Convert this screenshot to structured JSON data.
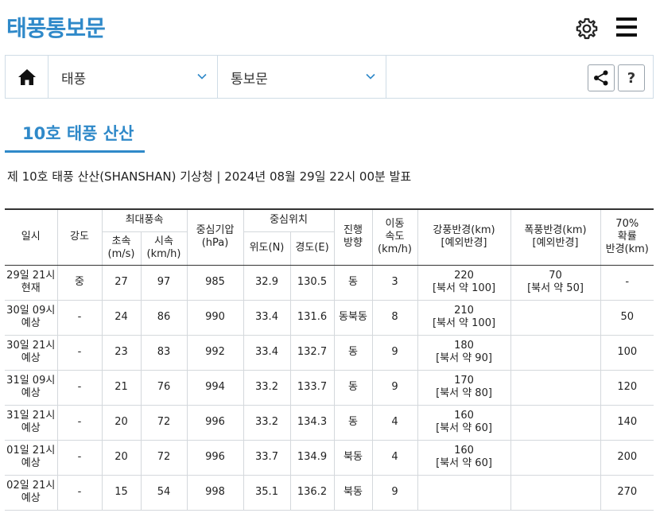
{
  "header": {
    "title": "태풍통보문"
  },
  "nav": {
    "select1": "태풍",
    "select2": "통보문",
    "help": "?"
  },
  "tab": {
    "label": "10호 태풍 산산"
  },
  "subtitle": "제 10호 태풍 산산(SHANSHAN) 기상청 | 2024년 08월 29일 22시 00분 발표",
  "table": {
    "headers": {
      "date": "일시",
      "intensity": "강도",
      "max_wind": "최대풍속",
      "wind_ms": [
        "초속",
        "(m/s)"
      ],
      "wind_kmh": [
        "시속",
        "(km/h)"
      ],
      "pressure": [
        "중심기압",
        "(hPa)"
      ],
      "position": "중심위치",
      "lat": "위도(N)",
      "lon": "경도(E)",
      "direction": [
        "진행",
        "방향"
      ],
      "speed": [
        "이동",
        "속도",
        "(km/h)"
      ],
      "strong_radius": [
        "강풍반경(km)",
        "[예외반경]"
      ],
      "storm_radius": [
        "폭풍반경(km)",
        "[예외반경]"
      ],
      "prob_radius": [
        "70%",
        "확률",
        "반경(km)"
      ]
    },
    "rows": [
      {
        "date": [
          "29일 21시",
          "현재"
        ],
        "intensity": "중",
        "wind_ms": "27",
        "wind_kmh": "97",
        "pressure": "985",
        "lat": "32.9",
        "lon": "130.5",
        "direction": "동",
        "speed": "3",
        "strong": [
          "220",
          "[북서 약 100]"
        ],
        "storm": [
          "70",
          "[북서 약 50]"
        ],
        "prob": "-"
      },
      {
        "date": [
          "30일 09시",
          "예상"
        ],
        "intensity": "-",
        "wind_ms": "24",
        "wind_kmh": "86",
        "pressure": "990",
        "lat": "33.4",
        "lon": "131.6",
        "direction": "동북동",
        "speed": "8",
        "strong": [
          "210",
          "[북서 약 100]"
        ],
        "storm": [
          "",
          ""
        ],
        "prob": "50"
      },
      {
        "date": [
          "30일 21시",
          "예상"
        ],
        "intensity": "-",
        "wind_ms": "23",
        "wind_kmh": "83",
        "pressure": "992",
        "lat": "33.4",
        "lon": "132.7",
        "direction": "동",
        "speed": "9",
        "strong": [
          "180",
          "[북서 약 90]"
        ],
        "storm": [
          "",
          ""
        ],
        "prob": "100"
      },
      {
        "date": [
          "31일 09시",
          "예상"
        ],
        "intensity": "-",
        "wind_ms": "21",
        "wind_kmh": "76",
        "pressure": "994",
        "lat": "33.2",
        "lon": "133.7",
        "direction": "동",
        "speed": "9",
        "strong": [
          "170",
          "[북서 약 80]"
        ],
        "storm": [
          "",
          ""
        ],
        "prob": "120"
      },
      {
        "date": [
          "31일 21시",
          "예상"
        ],
        "intensity": "-",
        "wind_ms": "20",
        "wind_kmh": "72",
        "pressure": "996",
        "lat": "33.2",
        "lon": "134.3",
        "direction": "동",
        "speed": "4",
        "strong": [
          "160",
          "[북서 약 60]"
        ],
        "storm": [
          "",
          ""
        ],
        "prob": "140"
      },
      {
        "date": [
          "01일 21시",
          "예상"
        ],
        "intensity": "-",
        "wind_ms": "20",
        "wind_kmh": "72",
        "pressure": "996",
        "lat": "33.7",
        "lon": "134.9",
        "direction": "북동",
        "speed": "4",
        "strong": [
          "160",
          "[북서 약 60]"
        ],
        "storm": [
          "",
          ""
        ],
        "prob": "200"
      },
      {
        "date": [
          "02일 21시",
          "예상"
        ],
        "intensity": "-",
        "wind_ms": "15",
        "wind_kmh": "54",
        "pressure": "998",
        "lat": "35.1",
        "lon": "136.2",
        "direction": "북동",
        "speed": "9",
        "strong": [
          "",
          ""
        ],
        "storm": [
          "",
          ""
        ],
        "prob": "270"
      }
    ]
  },
  "colors": {
    "accent": "#2f89c9",
    "border": "#d4d8dc"
  }
}
